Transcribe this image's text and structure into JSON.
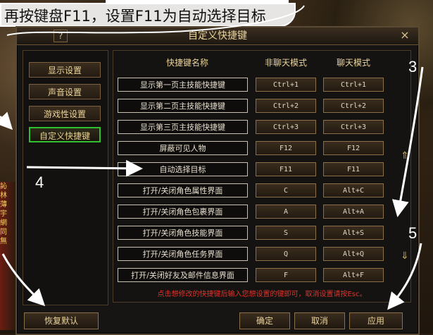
{
  "instruction": "再按键盘F11，设置F11为自动选择目标",
  "chat_fragments": [
    "訫",
    "林",
    "薄",
    "宇",
    "網",
    "同",
    "無"
  ],
  "window": {
    "title": "自定义快捷键",
    "help_label": "?",
    "close_label": "×"
  },
  "sidebar": {
    "items": [
      {
        "label": "显示设置"
      },
      {
        "label": "声音设置"
      },
      {
        "label": "游戏性设置"
      },
      {
        "label": "自定义快捷键"
      }
    ]
  },
  "table": {
    "headers": [
      "快捷键名称",
      "非聊天模式",
      "聊天模式"
    ],
    "rows": [
      {
        "name": "显示第一页主技能快捷键",
        "normal": "Ctrl+1",
        "chat": "Ctrl+1"
      },
      {
        "name": "显示第二页主技能快捷键",
        "normal": "Ctrl+2",
        "chat": "Ctrl+2"
      },
      {
        "name": "显示第三页主技能快捷键",
        "normal": "Ctrl+3",
        "chat": "Ctrl+3"
      },
      {
        "name": "屏蔽可见人物",
        "normal": "F12",
        "chat": "F12"
      },
      {
        "name": "自动选择目标",
        "normal": "F11",
        "chat": "F11"
      },
      {
        "name": "打开/关闭角色属性界面",
        "normal": "C",
        "chat": "Alt+C"
      },
      {
        "name": "打开/关闭角色包裹界面",
        "normal": "A",
        "chat": "Alt+A"
      },
      {
        "name": "打开/关闭角色技能界面",
        "normal": "S",
        "chat": "Alt+S"
      },
      {
        "name": "打开/关闭角色任务界面",
        "normal": "Q",
        "chat": "Alt+Q"
      },
      {
        "name": "打开/关闭好友及邮件信息界面",
        "normal": "F",
        "chat": "Alt+F"
      }
    ],
    "tip": "点击想修改的快捷键后输入您想设置的键即可，取消设置请按Esc。"
  },
  "buttons": {
    "restore_default": "恢复默认",
    "ok": "确定",
    "cancel": "取消",
    "apply": "应用"
  },
  "annotations": {
    "step3": "3",
    "step4": "4",
    "step5": "5"
  }
}
